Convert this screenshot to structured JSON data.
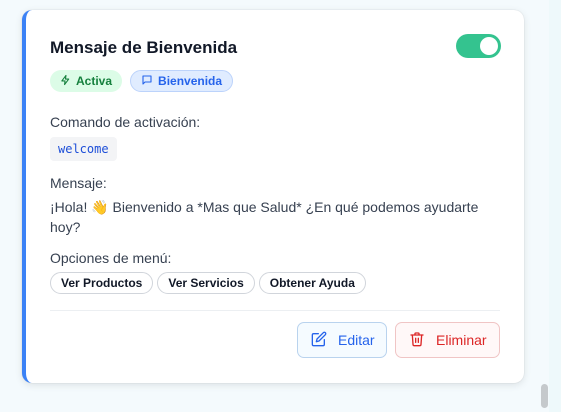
{
  "card": {
    "title": "Mensaje de Bienvenida",
    "enabled": true,
    "badges": {
      "status": "Activa",
      "category": "Bienvenida"
    },
    "command_label": "Comando de activación:",
    "command": "welcome",
    "message_label": "Mensaje:",
    "message": "¡Hola! 👋 Bienvenido a *Mas que Salud* ¿En qué podemos ayudarte hoy?",
    "menu_label": "Opciones de menú:",
    "menu_options": [
      "Ver Productos",
      "Ver Servicios",
      "Obtener Ayuda"
    ],
    "actions": {
      "edit": "Editar",
      "delete": "Eliminar"
    }
  },
  "colors": {
    "accent": "#3b82f6",
    "toggle_on": "#34c38f",
    "active_badge_bg": "#dcfce7",
    "active_badge_text": "#15803d",
    "delete": "#dc2626"
  },
  "icons": {
    "status_badge": "lightning-icon",
    "category_badge": "message-square-icon",
    "edit_button": "edit-icon",
    "delete_button": "trash-icon"
  }
}
